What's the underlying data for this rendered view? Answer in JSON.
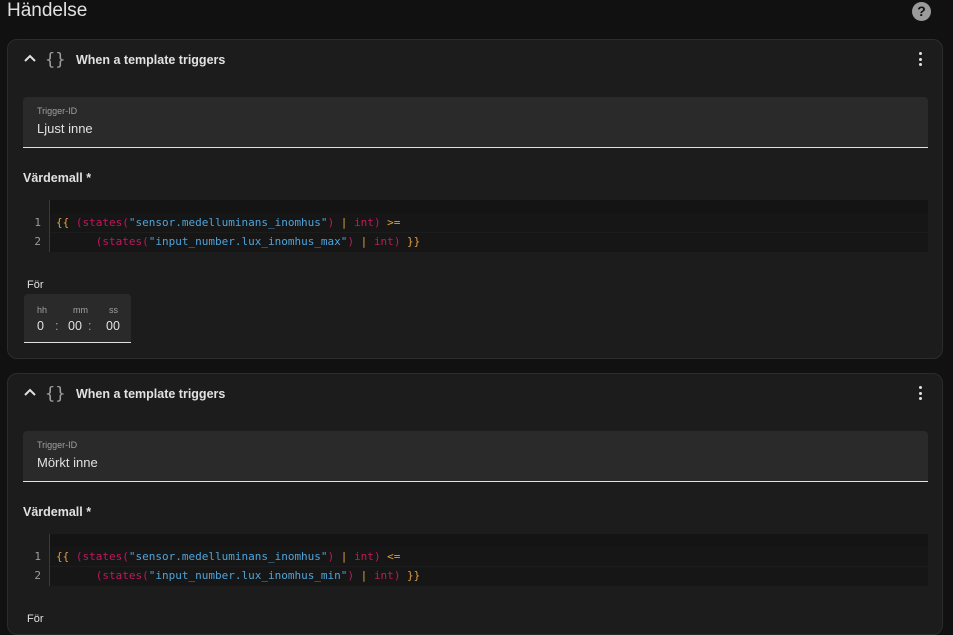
{
  "page": {
    "title": "Händelse",
    "help_icon": "help-circle-icon"
  },
  "triggers": [
    {
      "title": "When a template triggers",
      "trigger_id_label": "Trigger-ID",
      "trigger_id_value": "Ljust inne",
      "template_label": "Värdemall *",
      "code_lines": [
        {
          "num": "1",
          "tokens": [
            {
              "t": "{{ ",
              "c": "c-brace"
            },
            {
              "t": "(",
              "c": "c-paren"
            },
            {
              "t": "states",
              "c": "c-fn"
            },
            {
              "t": "(",
              "c": "c-paren"
            },
            {
              "t": "\"sensor.medelluminans_inomhus\"",
              "c": "c-str"
            },
            {
              "t": ")",
              "c": "c-paren"
            },
            {
              "t": " | ",
              "c": "c-op"
            },
            {
              "t": "int",
              "c": "c-kw"
            },
            {
              "t": ")",
              "c": "c-paren"
            },
            {
              "t": " >=",
              "c": "c-op"
            }
          ]
        },
        {
          "num": "2",
          "tokens": [
            {
              "t": "      ",
              "c": ""
            },
            {
              "t": "(",
              "c": "c-paren"
            },
            {
              "t": "states",
              "c": "c-fn"
            },
            {
              "t": "(",
              "c": "c-paren"
            },
            {
              "t": "\"input_number.lux_inomhus_max\"",
              "c": "c-str"
            },
            {
              "t": ")",
              "c": "c-paren"
            },
            {
              "t": " | ",
              "c": "c-op"
            },
            {
              "t": "int",
              "c": "c-kw"
            },
            {
              "t": ")",
              "c": "c-paren"
            },
            {
              "t": " }}",
              "c": "c-brace"
            }
          ]
        }
      ],
      "for_label": "För",
      "duration": {
        "hh_label": "hh",
        "mm_label": "mm",
        "ss_label": "ss",
        "hh": "0",
        "mm": "00",
        "ss": "00",
        "sep": ":"
      }
    },
    {
      "title": "When a template triggers",
      "trigger_id_label": "Trigger-ID",
      "trigger_id_value": "Mörkt inne",
      "template_label": "Värdemall *",
      "code_lines": [
        {
          "num": "1",
          "tokens": [
            {
              "t": "{{ ",
              "c": "c-brace"
            },
            {
              "t": "(",
              "c": "c-paren"
            },
            {
              "t": "states",
              "c": "c-fn"
            },
            {
              "t": "(",
              "c": "c-paren"
            },
            {
              "t": "\"sensor.medelluminans_inomhus\"",
              "c": "c-str"
            },
            {
              "t": ")",
              "c": "c-paren"
            },
            {
              "t": " | ",
              "c": "c-op"
            },
            {
              "t": "int",
              "c": "c-kw"
            },
            {
              "t": ")",
              "c": "c-paren"
            },
            {
              "t": " <=",
              "c": "c-op"
            }
          ]
        },
        {
          "num": "2",
          "tokens": [
            {
              "t": "      ",
              "c": ""
            },
            {
              "t": "(",
              "c": "c-paren"
            },
            {
              "t": "states",
              "c": "c-fn"
            },
            {
              "t": "(",
              "c": "c-paren"
            },
            {
              "t": "\"input_number.lux_inomhus_min\"",
              "c": "c-str"
            },
            {
              "t": ")",
              "c": "c-paren"
            },
            {
              "t": " | ",
              "c": "c-op"
            },
            {
              "t": "int",
              "c": "c-kw"
            },
            {
              "t": ")",
              "c": "c-paren"
            },
            {
              "t": " }}",
              "c": "c-brace"
            }
          ]
        }
      ],
      "for_label": "För"
    }
  ],
  "icons": {
    "collapse": "chevron-up-icon",
    "template": "code-braces-icon",
    "menu": "dots-vertical-icon"
  }
}
